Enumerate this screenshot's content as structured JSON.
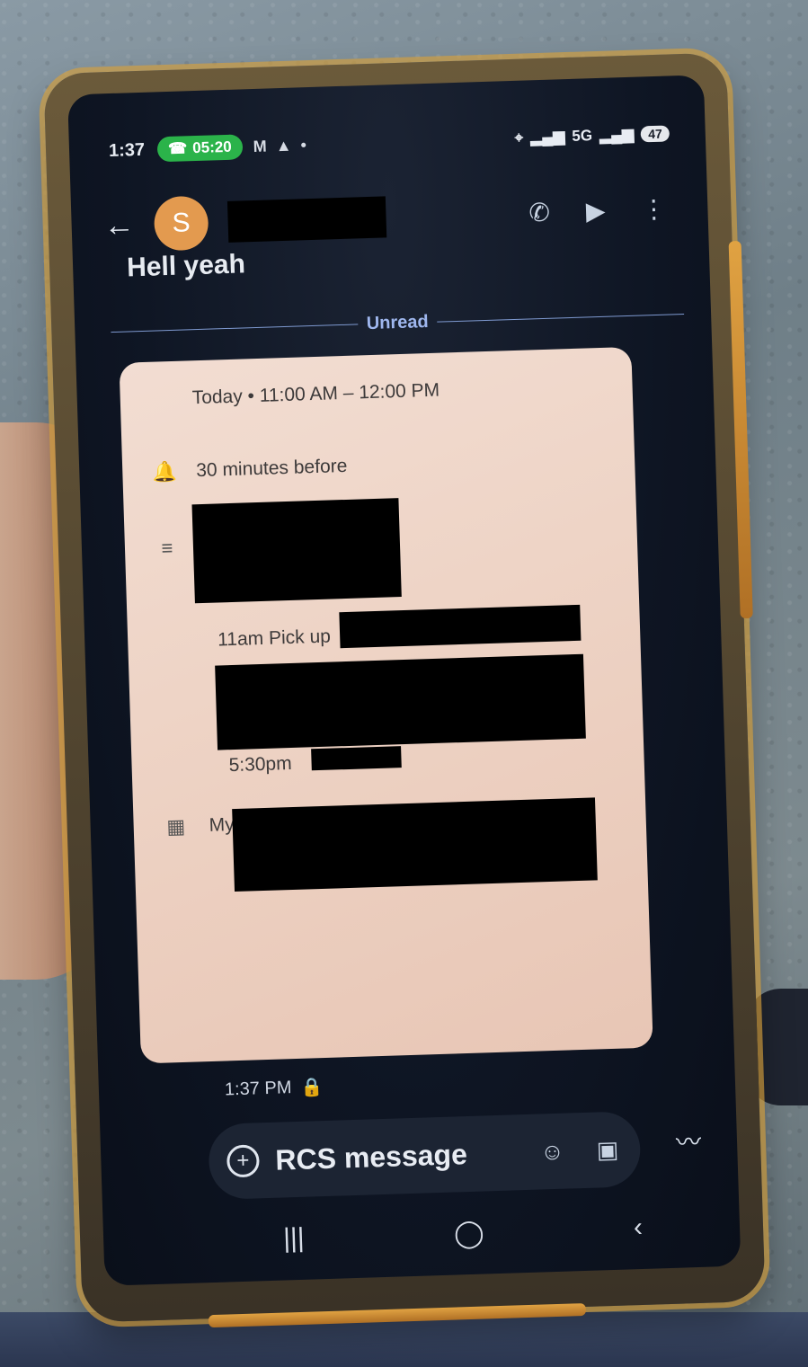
{
  "status_bar": {
    "time": "1:37",
    "call_timer": "05:20",
    "network": "5G",
    "battery": "47"
  },
  "conversation": {
    "avatar_letter": "S",
    "previous_message": "Hell yeah",
    "unread_label": "Unread"
  },
  "event_card": {
    "date_time": "Today  •  11:00 AM – 12:00 PM",
    "reminder": "30 minutes before",
    "description_line1": "11am Pick up",
    "description_line2": "5:30pm",
    "calendar": "My calendar"
  },
  "message_meta": {
    "timestamp": "1:37 PM"
  },
  "composer": {
    "placeholder": "RCS message"
  },
  "icons": {
    "back": "arrow-left-icon",
    "phone": "phone-icon",
    "video": "video-icon",
    "more": "more-vert-icon",
    "bell": "bell-icon",
    "notes": "notes-icon",
    "calendar": "calendar-icon",
    "lock": "lock-icon",
    "add": "add-circle-icon",
    "emoji": "emoji-icon",
    "gallery": "gallery-icon",
    "voice": "voice-icon"
  }
}
